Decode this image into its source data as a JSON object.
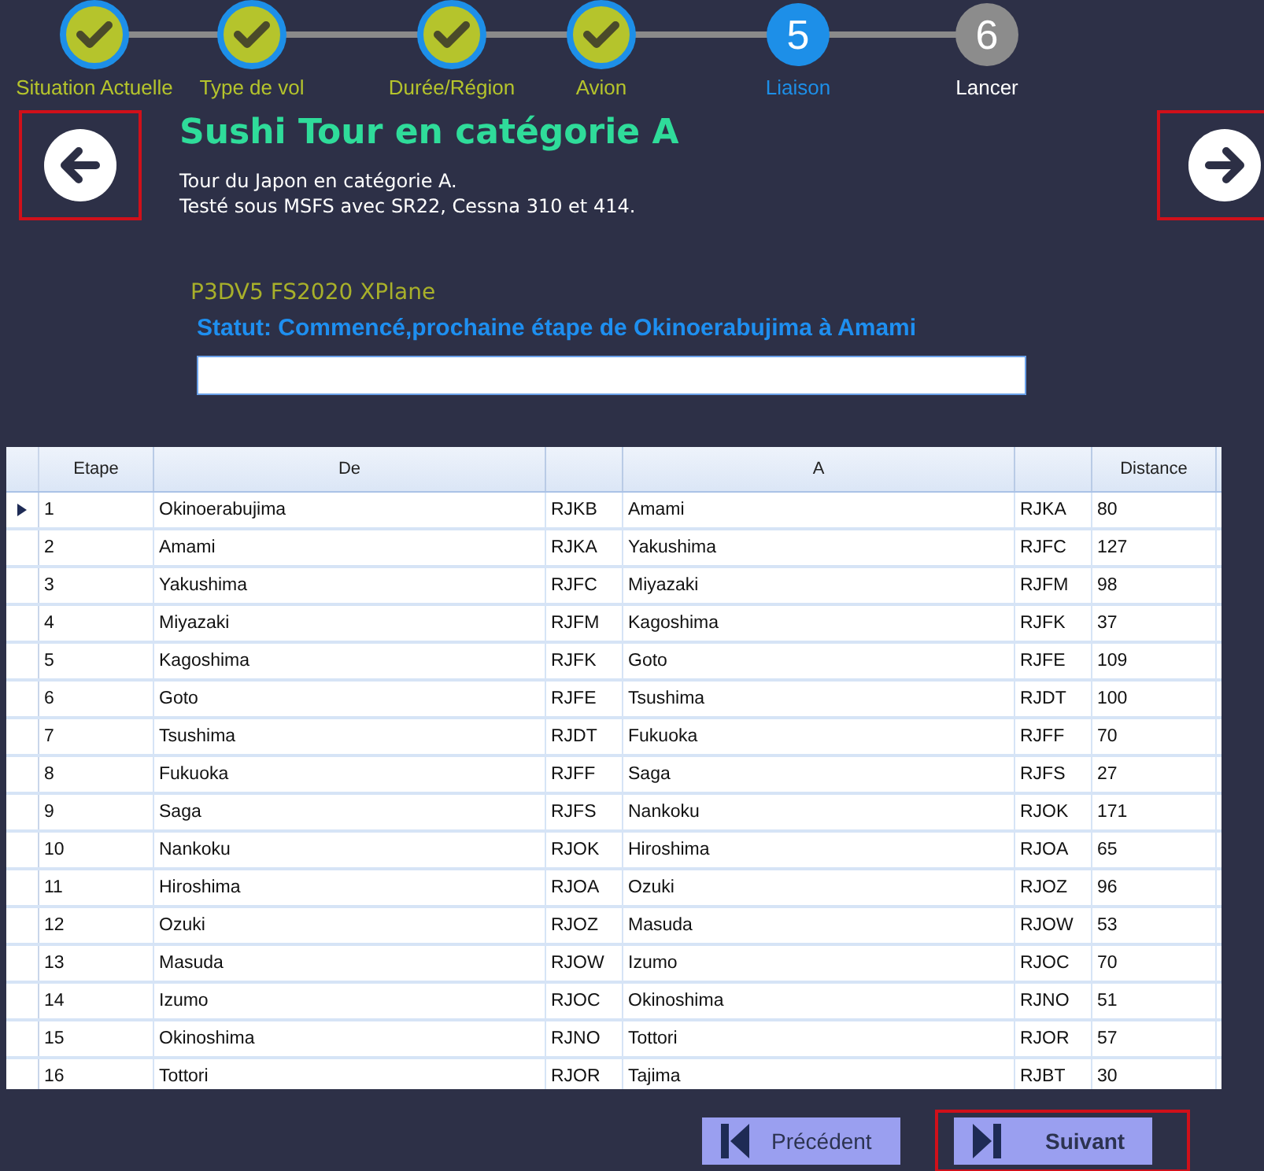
{
  "steps": [
    {
      "label": "Situation Actuelle",
      "done": true,
      "selected": false
    },
    {
      "label": "Type de vol",
      "done": true,
      "selected": false
    },
    {
      "label": "Durée/Région",
      "done": true,
      "selected": false
    },
    {
      "label": "Avion",
      "done": true,
      "selected": false
    },
    {
      "label": "Liaison",
      "number": "5",
      "done": false,
      "selected": true
    },
    {
      "label": "Lancer",
      "number": "6",
      "done": false,
      "selected": false
    }
  ],
  "nav": {
    "back_highlighted": true,
    "forward_highlighted": true
  },
  "title": "Sushi Tour en catégorie A",
  "description": [
    "Tour du Japon en catégorie A.",
    "Testé sous MSFS avec SR22, Cessna 310 et 414."
  ],
  "simulators": "P3DV5 FS2020 XPlane",
  "status": "Statut: Commencé,prochaine étape de Okinoerabujima à Amami",
  "table": {
    "columns": [
      "Etape",
      "De",
      "",
      "A",
      "",
      "Distance"
    ],
    "rows": [
      {
        "cells": [
          "1",
          "Okinoerabujima",
          "RJKB",
          "Amami",
          "RJKA",
          "80"
        ],
        "current": true
      },
      {
        "cells": [
          "2",
          "Amami",
          "RJKA",
          "Yakushima",
          "RJFC",
          "127"
        ],
        "current": false
      },
      {
        "cells": [
          "3",
          "Yakushima",
          "RJFC",
          "Miyazaki",
          "RJFM",
          "98"
        ],
        "current": false
      },
      {
        "cells": [
          "4",
          "Miyazaki",
          "RJFM",
          "Kagoshima",
          "RJFK",
          "37"
        ],
        "current": false
      },
      {
        "cells": [
          "5",
          "Kagoshima",
          "RJFK",
          "Goto",
          "RJFE",
          "109"
        ],
        "current": false
      },
      {
        "cells": [
          "6",
          "Goto",
          "RJFE",
          "Tsushima",
          "RJDT",
          "100"
        ],
        "current": false
      },
      {
        "cells": [
          "7",
          "Tsushima",
          "RJDT",
          "Fukuoka",
          "RJFF",
          "70"
        ],
        "current": false
      },
      {
        "cells": [
          "8",
          "Fukuoka",
          "RJFF",
          "Saga",
          "RJFS",
          "27"
        ],
        "current": false
      },
      {
        "cells": [
          "9",
          "Saga",
          "RJFS",
          "Nankoku",
          "RJOK",
          "171"
        ],
        "current": false
      },
      {
        "cells": [
          "10",
          "Nankoku",
          "RJOK",
          "Hiroshima",
          "RJOA",
          "65"
        ],
        "current": false
      },
      {
        "cells": [
          "11",
          "Hiroshima",
          "RJOA",
          "Ozuki",
          "RJOZ",
          "96"
        ],
        "current": false
      },
      {
        "cells": [
          "12",
          "Ozuki",
          "RJOZ",
          "Masuda",
          "RJOW",
          "53"
        ],
        "current": false
      },
      {
        "cells": [
          "13",
          "Masuda",
          "RJOW",
          "Izumo",
          "RJOC",
          "70"
        ],
        "current": false
      },
      {
        "cells": [
          "14",
          "Izumo",
          "RJOC",
          "Okinoshima",
          "RJNO",
          "51"
        ],
        "current": false
      },
      {
        "cells": [
          "15",
          "Okinoshima",
          "RJNO",
          "Tottori",
          "RJOR",
          "57"
        ],
        "current": false
      },
      {
        "cells": [
          "16",
          "Tottori",
          "RJOR",
          "Tajima",
          "RJBT",
          "30"
        ],
        "current": false
      }
    ]
  },
  "buttons": [
    {
      "label": "Précédent",
      "kind": "previous",
      "highlighted": false
    },
    {
      "label": "Suivant",
      "kind": "next",
      "highlighted": true
    }
  ]
}
